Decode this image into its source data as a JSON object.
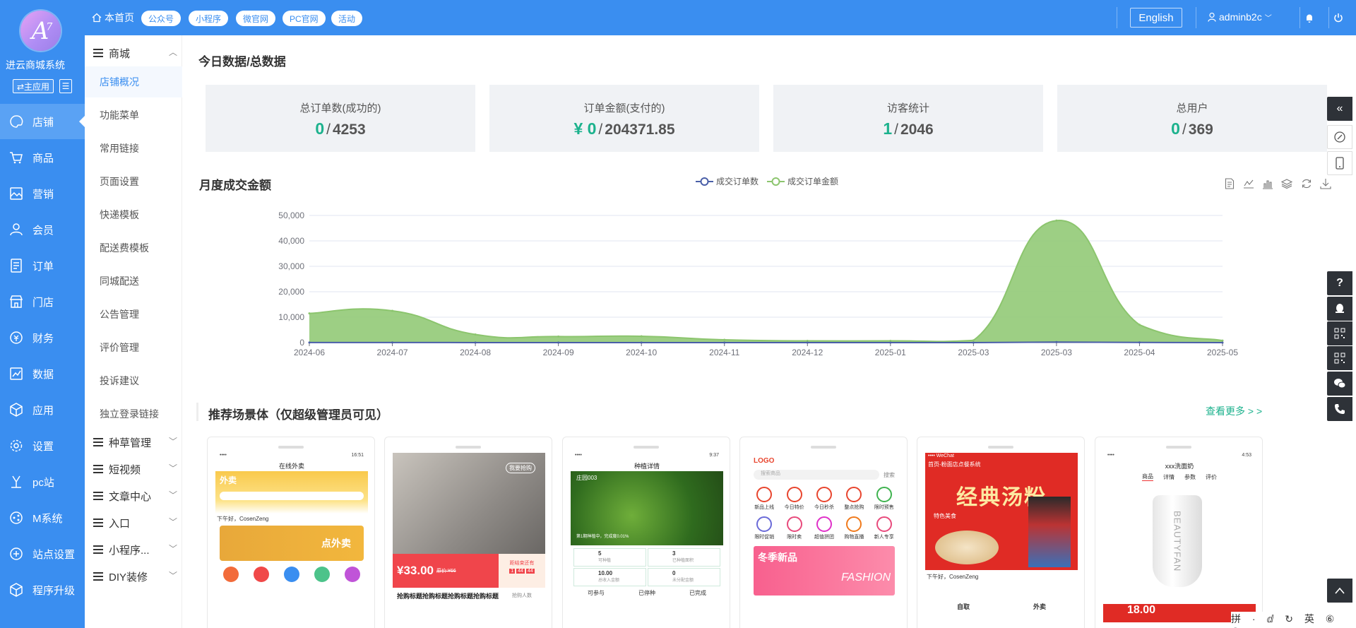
{
  "app": {
    "shop_name": "进云商城系统",
    "main_app_label": "⇄主应用"
  },
  "nav": [
    {
      "label": "店铺",
      "icon": "palette-icon",
      "active": true
    },
    {
      "label": "商品",
      "icon": "cart-icon"
    },
    {
      "label": "营销",
      "icon": "image-icon"
    },
    {
      "label": "会员",
      "icon": "user-icon"
    },
    {
      "label": "订单",
      "icon": "order-icon"
    },
    {
      "label": "门店",
      "icon": "store-icon"
    },
    {
      "label": "财务",
      "icon": "coin-icon"
    },
    {
      "label": "数据",
      "icon": "chart-icon"
    },
    {
      "label": "应用",
      "icon": "cube-icon"
    },
    {
      "label": "设置",
      "icon": "gear-icon"
    },
    {
      "label": "pc站",
      "icon": "pc-icon"
    },
    {
      "label": "M系统",
      "icon": "share-icon"
    },
    {
      "label": "站点设置",
      "icon": "site-icon"
    },
    {
      "label": "程序升级",
      "icon": "upgrade-icon"
    }
  ],
  "submenu": {
    "group_shop": "商城",
    "items": [
      "店铺概况",
      "功能菜单",
      "常用链接",
      "页面设置",
      "快递模板",
      "配送费模板",
      "同城配送",
      "公告管理",
      "评价管理",
      "投诉建议",
      "独立登录链接"
    ],
    "groups": [
      "种草管理",
      "短视频",
      "文章中心",
      "入口",
      "小程序...",
      "DIY装修"
    ]
  },
  "topbar": {
    "home": "本首页",
    "tags": [
      "公众号",
      "小程序",
      "微官网",
      "PC官网",
      "活动"
    ],
    "lang": "English",
    "user": "adminb2c"
  },
  "stats": {
    "title": "今日数据/总数据",
    "cards": [
      {
        "label": "总订单数(成功的)",
        "prefix": "",
        "today": "0",
        "total": "4253"
      },
      {
        "label": "订单金额(支付的)",
        "prefix": "¥ ",
        "today": "0",
        "total": "204371.85"
      },
      {
        "label": "访客统计",
        "prefix": "",
        "today": "1",
        "total": "2046"
      },
      {
        "label": "总用户",
        "prefix": "",
        "today": "0",
        "total": "369"
      }
    ]
  },
  "chart_title": "月度成交金额",
  "chart_data": {
    "type": "area",
    "categories": [
      "2024-06",
      "2024-07",
      "2024-08",
      "2024-09",
      "2024-10",
      "2024-11",
      "2024-12",
      "2025-01",
      "2025-03",
      "2025-03",
      "2025-04",
      "2025-05"
    ],
    "series": [
      {
        "name": "成交订单数",
        "color": "#4a5fa8",
        "values": [
          20,
          30,
          15,
          10,
          12,
          8,
          5,
          5,
          8,
          200,
          60,
          10
        ]
      },
      {
        "name": "成交订单金额",
        "color": "#8cc56e",
        "values": [
          11500,
          12500,
          3200,
          2400,
          2500,
          1100,
          700,
          700,
          900,
          48000,
          7000,
          800
        ]
      }
    ],
    "ylim": [
      0,
      50000
    ],
    "yticks": [
      "0",
      "10,000",
      "20,000",
      "30,000",
      "40,000",
      "50,000"
    ],
    "grid": true,
    "legend": "top-center"
  },
  "recommend": {
    "title": "推荐场景体（仅超级管理员可见）",
    "more": "查看更多 > >"
  },
  "scenes": [
    {
      "title": "在线外卖",
      "store": "外卖",
      "greeting": "下午好，CosenZeng",
      "banner": "点外卖"
    },
    {
      "price": "¥33.00",
      "orig": "原价:¥66",
      "countdown_label": "距结束还有",
      "times": [
        "1",
        "44",
        "44"
      ],
      "desc": "抢购标题抢购标题抢购标题抢购标题",
      "buyers": "抢购人数",
      "cta": "我要抢购"
    },
    {
      "title": "种植详情",
      "field": "庄园003",
      "progress": "第1期种植中，完成度0.01%",
      "stats": [
        {
          "v": "5",
          "l": "可种植"
        },
        {
          "v": "3",
          "l": "已种植面积"
        },
        {
          "v": "10.00",
          "l": "总收入金额"
        },
        {
          "v": "0",
          "l": "未分配金额"
        }
      ],
      "tabs": [
        "可参与",
        "已停种",
        "已完成"
      ]
    },
    {
      "logo": "LOGO",
      "search": "搜索商品",
      "search_btn": "搜索",
      "icons": [
        "新品上线",
        "今日特价",
        "今日秒杀",
        "整点抢购",
        "限时预售",
        "限时促销",
        "限时卖",
        "超值拼团",
        "购物直播",
        "新人专享"
      ],
      "banner": "冬季新品",
      "banner_sub": "FASHION"
    },
    {
      "title": "首页-粉面店点餐系统",
      "shop": "经典汤粉",
      "sub": "特色美食",
      "greeting": "下午好，CosenZeng",
      "btns": [
        "自取",
        "外卖"
      ]
    },
    {
      "title": "xxx洗面奶",
      "tabs": [
        "商品",
        "详情",
        "参数",
        "评价"
      ],
      "brand": "BEAUTYFAN",
      "price": "18.00"
    }
  ],
  "ime": "拼 · ⅆ ↻ 英 ⑥ ⑦"
}
